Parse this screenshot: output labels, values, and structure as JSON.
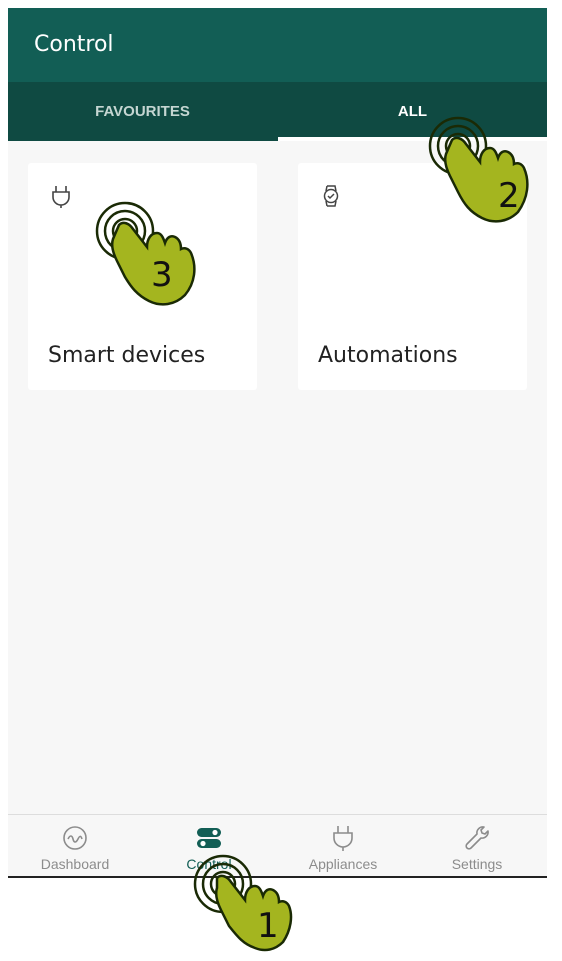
{
  "appbar": {
    "title": "Control"
  },
  "tabs": [
    {
      "label": "FAVOURITES",
      "active": false
    },
    {
      "label": "ALL",
      "active": true
    }
  ],
  "cards": [
    {
      "label": "Smart devices",
      "icon": "plug-icon"
    },
    {
      "label": "Automations",
      "icon": "watch-icon"
    }
  ],
  "bottom_nav": [
    {
      "label": "Dashboard",
      "icon": "dashboard-icon",
      "active": false
    },
    {
      "label": "Control",
      "icon": "toggle-icon",
      "active": true
    },
    {
      "label": "Appliances",
      "icon": "plug-icon",
      "active": false
    },
    {
      "label": "Settings",
      "icon": "wrench-icon",
      "active": false
    }
  ],
  "annotations": [
    {
      "number": "1"
    },
    {
      "number": "2"
    },
    {
      "number": "3"
    }
  ],
  "colors": {
    "appbar": "#125e55",
    "tabbar": "#0f4a42",
    "hand_fill": "#a4b51f",
    "hand_stroke": "#1a2a05",
    "background": "#f7f7f7"
  }
}
